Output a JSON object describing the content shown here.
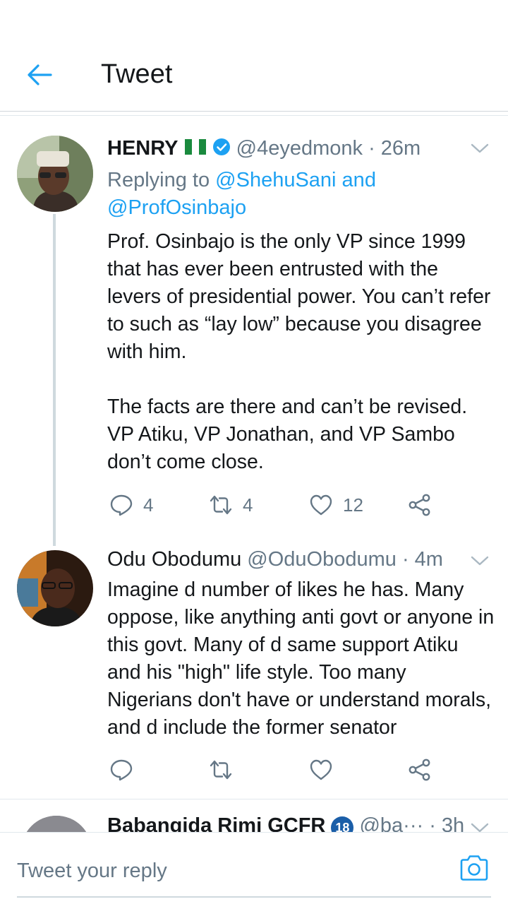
{
  "header": {
    "title": "Tweet"
  },
  "tweets": [
    {
      "name": "HENRY",
      "flag_emoji": "🇳🇬",
      "handle": "@4eyedmonk",
      "time": "· 26m",
      "replying_prefix": "Replying to ",
      "replying_to_1": "@ShehuSani",
      "replying_and": " and",
      "replying_to_2": "@ProfOsinbajo",
      "text": "Prof. Osinbajo is the only VP since 1999 that has ever been entrusted with the levers of presidential power. You can’t refer to such as “lay low” because you disagree with him.\n\nThe facts are there and can’t be revised. VP Atiku, VP Jonathan, and VP Sambo don’t come close.",
      "replies": "4",
      "retweets": "4",
      "likes": "12"
    },
    {
      "name": "Odu Obodumu",
      "handle": "@OduObodumu",
      "time": "· 4m",
      "text": "Imagine d number of likes he has. Many oppose, like anything anti govt or anyone in this govt. Many of d same support Atiku and his \"high\" life style. Too many Nigerians don't have or understand morals, and d include the former senator"
    },
    {
      "name": "Babangida Rimi GCFR",
      "badge": "18",
      "handle": "@ba···",
      "time": "· 3h"
    }
  ],
  "reply_bar": {
    "placeholder": "Tweet your reply"
  },
  "colors": {
    "accent": "#1da1f2",
    "verified": "#1da1f2",
    "muted": "#657786"
  }
}
